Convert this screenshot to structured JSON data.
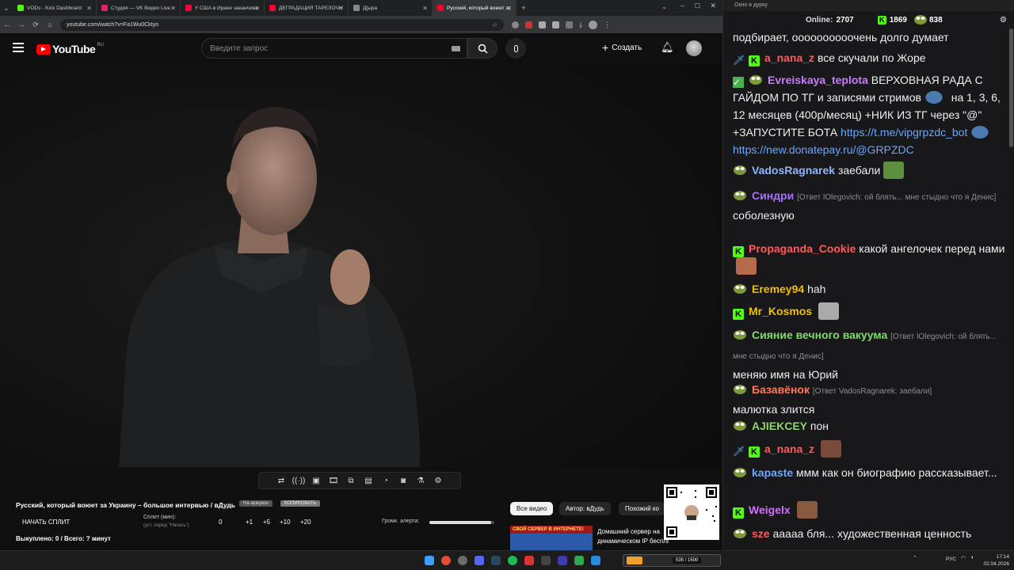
{
  "browser": {
    "tabs": [
      {
        "label": "VODs - Kick Dashboard",
        "color": "#53fc18"
      },
      {
        "label": "Студия — VK Видео Live",
        "color": "#e0245e"
      },
      {
        "label": "У США в Иране заканчиваются",
        "color": "#ff0033"
      },
      {
        "label": "ДЕГРАДАЦИЯ ТАРЕЛОЧНИЦ",
        "color": "#ff0033"
      },
      {
        "label": "Д[ыра",
        "color": "#888888"
      },
      {
        "label": "Русский, который воюет за У",
        "color": "#ff0033"
      }
    ],
    "new_tab": "+",
    "url": "youtube.com/watch?v=Fa1Wu0Cktyo"
  },
  "youtube": {
    "logo": "YouTube",
    "region": "RU",
    "search_placeholder": "Введите запрос",
    "create_label": "Создать"
  },
  "below": {
    "video_title": "Русский, который воюет за Украину – большое интервью / вДудь",
    "btn_auction": "На аукцион",
    "btn_copy": "КОПИРОВАТЬ",
    "start_split": "НАЧАТЬ СПЛИТ",
    "split_label": "Сплит (мин):",
    "split_hint": "(уст. перед \"Начать\")",
    "split_value": "0",
    "split_steps": [
      "+1",
      "+5",
      "+10",
      "+20"
    ],
    "volume_label": "Громк. алерта:",
    "volume_level": 0.95,
    "bought": "Выкуплено: 0 / Всего: ? минут",
    "filters": [
      "Все видео",
      "Автор: вДудь",
      "Похожий ко"
    ],
    "rec_thumb_text": "СВОЙ СЕРВЕР В ИНТЕРНЕТЕ!",
    "rec_title_1": "Домашний сервер на",
    "rec_title_2": "динамическом IP бесплатно!..."
  },
  "chat": {
    "window_title": "Окно в дурку",
    "online_label": "Online:",
    "online_count": "2707",
    "kick_count": "1869",
    "other_count": "838",
    "messages": [
      {
        "text": "подбирает, оооооооооочень долго думает"
      },
      {
        "nick": "a_nana_z",
        "color": "#ff5a5a",
        "text": "все скучали по Жоре"
      },
      {
        "nick": "Evreiskaya_teplota",
        "color": "#c77dff",
        "text": "ВЕРХОВНАЯ РАДА С ГАЙДОМ ПО ТГ и записями стримов",
        "text2": "на 1, 3, 6, 12 месяцев (400р/месяц) +НИК ИЗ ТГ через \"@\" +ЗАПУСТИТЕ БОТА",
        "link1": "https://t.me/vipgrpzdc_bot",
        "link2": "https://new.donatepay.ru/@GRPZDC"
      },
      {
        "nick": "VadosRagnarek",
        "color": "#8fb6ff",
        "text": "заебали"
      },
      {
        "nick": "Синдри",
        "color": "#a970ff",
        "reply": "[Ответ lOlegovich: ой блять... мне стыдно что я Денис]",
        "text": "соболезную"
      },
      {
        "nick": "Propaganda_Cookie",
        "color": "#ff5a5a",
        "text": "какой ангелочек перед нами"
      },
      {
        "nick": "Eremey94",
        "color": "#f0c000",
        "text": "hah"
      },
      {
        "nick": "Mr_Kosmos",
        "color": "#f0c000",
        "text": ""
      },
      {
        "nick": "Сияние вечного вакуума",
        "color": "#7ddc6b",
        "reply": "[Ответ lOlegovich: ой блять... мне стыдно что я Денис]",
        "text": "меняю имя на Юрий"
      },
      {
        "nick": "Базавёнок",
        "color": "#ff7a5a",
        "reply": "[Ответ VadosRagnarek: заебали]",
        "text": "малютка злится"
      },
      {
        "nick": "AJIEKCEY",
        "color": "#8fd36a",
        "text": "пон"
      },
      {
        "nick": "a_nana_z",
        "color": "#ff5a5a",
        "text": ""
      },
      {
        "nick": "kapaste",
        "color": "#6aa7ff",
        "text": "ммм как он биографию рассказывает..."
      },
      {
        "nick": "Weigelx",
        "color": "#d070ff",
        "text": ""
      },
      {
        "nick": "sze",
        "color": "#ff5a5a",
        "text": "ааааа бля... художественная ценность"
      }
    ]
  },
  "taskbar": {
    "lang": "РУС",
    "time": "17:14",
    "date": "02.04.2026",
    "widget_text": "535 / 1500"
  }
}
